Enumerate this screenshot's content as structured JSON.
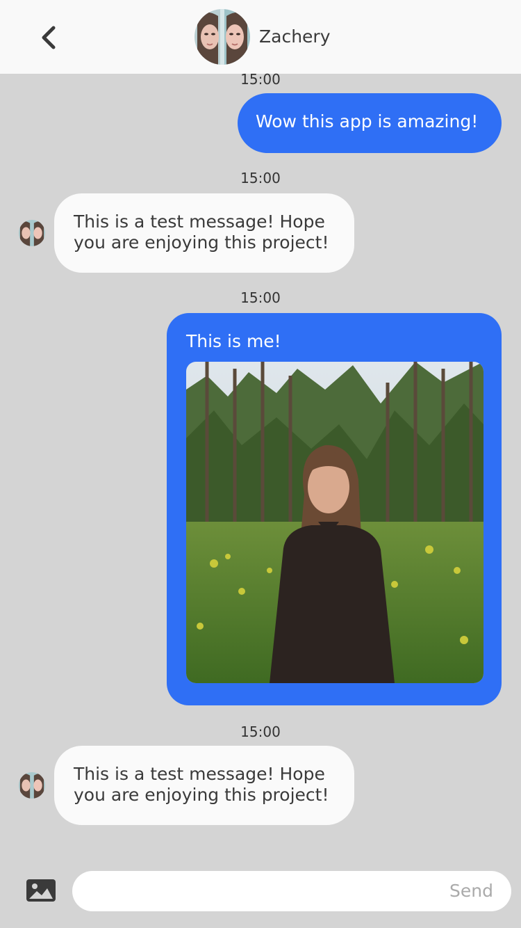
{
  "header": {
    "contact_name": "Zachery"
  },
  "messages": [
    {
      "time": "15:00",
      "direction": "outgoing",
      "text": "Wow this app is amazing!"
    },
    {
      "time": "15:00",
      "direction": "incoming",
      "text": "This is a test message! Hope you are enjoying this project!"
    },
    {
      "time": "15:00",
      "direction": "outgoing",
      "text": "This is me!",
      "has_photo": true
    },
    {
      "time": "15:00",
      "direction": "incoming",
      "text": "This is a test message! Hope you are enjoying this project!"
    }
  ],
  "composer": {
    "send_label": "Send",
    "input_value": "",
    "input_placeholder": ""
  },
  "icons": {
    "back": "chevron-left-icon",
    "attach": "image-icon"
  },
  "colors": {
    "outgoing_bubble": "#2f6ff5",
    "incoming_bubble": "#fafafa",
    "background": "#d4d4d4",
    "header": "#f9f9f9"
  }
}
